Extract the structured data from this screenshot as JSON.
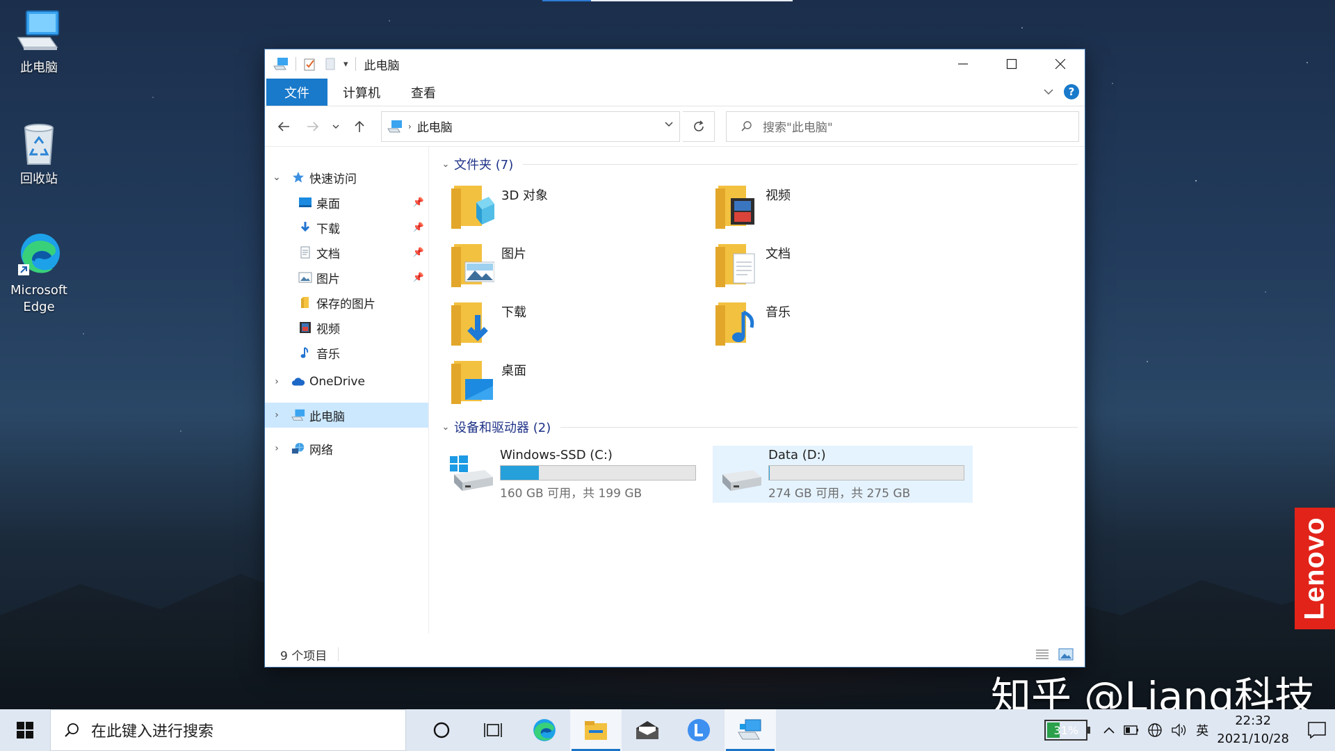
{
  "desktop": {
    "icons": [
      {
        "label": "此电脑"
      },
      {
        "label": "回收站"
      },
      {
        "label": "Microsoft Edge"
      }
    ],
    "watermark": "知乎 @Liang科技",
    "brand": "Lenovo"
  },
  "window": {
    "title": "此电脑",
    "ribbon_tabs": [
      "文件",
      "计算机",
      "查看"
    ],
    "help_label": "?",
    "address": {
      "path": "此电脑"
    },
    "search": {
      "placeholder": "搜索\"此电脑\""
    },
    "navigation": [
      {
        "label": "快速访问",
        "icon": "star-icon",
        "expanded": true
      },
      {
        "label": "桌面",
        "icon": "desktop-icon",
        "pinned": true
      },
      {
        "label": "下载",
        "icon": "download-icon",
        "pinned": true
      },
      {
        "label": "文档",
        "icon": "document-icon",
        "pinned": true
      },
      {
        "label": "图片",
        "icon": "picture-icon",
        "pinned": true
      },
      {
        "label": "保存的图片",
        "icon": "folder-icon"
      },
      {
        "label": "视频",
        "icon": "video-icon"
      },
      {
        "label": "音乐",
        "icon": "music-icon"
      },
      {
        "label": "OneDrive",
        "icon": "cloud-icon"
      },
      {
        "label": "此电脑",
        "icon": "computer-icon",
        "selected": true
      },
      {
        "label": "网络",
        "icon": "network-icon"
      }
    ],
    "folders_group": {
      "label": "文件夹 (7)"
    },
    "folders": [
      {
        "name": "3D 对象"
      },
      {
        "name": "视频"
      },
      {
        "name": "图片"
      },
      {
        "name": "文档"
      },
      {
        "name": "下载"
      },
      {
        "name": "音乐"
      },
      {
        "name": "桌面"
      }
    ],
    "drives_group": {
      "label": "设备和驱动器 (2)"
    },
    "drives": [
      {
        "name": "Windows-SSD (C:)",
        "size": "160 GB 可用，共 199 GB",
        "used_fraction": 0.196
      },
      {
        "name": "Data (D:)",
        "size": "274 GB 可用，共 275 GB",
        "used_fraction": 0.004
      }
    ],
    "status": {
      "items": "9 个项目"
    }
  },
  "taskbar": {
    "search_placeholder": "在此键入进行搜索",
    "battery": "31%",
    "battery_level": 0.31,
    "ime": "英",
    "time": "22:32",
    "date": "2021/10/28"
  },
  "colors": {
    "accent": "#1979ca",
    "selection": "#cce8ff",
    "drive_bar": "#26a0da"
  }
}
